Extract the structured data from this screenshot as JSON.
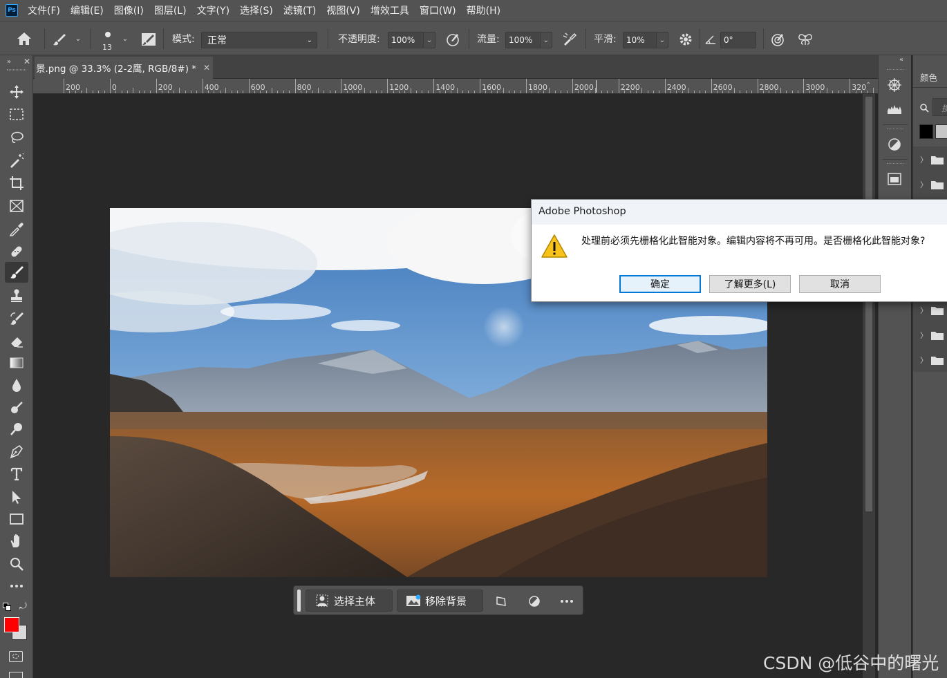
{
  "app": {
    "logo_text": "Ps"
  },
  "menu": [
    "文件(F)",
    "编辑(E)",
    "图像(I)",
    "图层(L)",
    "文字(Y)",
    "选择(S)",
    "滤镜(T)",
    "视图(V)",
    "增效工具",
    "窗口(W)",
    "帮助(H)"
  ],
  "options": {
    "brush_size": "13",
    "mode_label": "模式:",
    "mode_value": "正常",
    "opacity_label": "不透明度:",
    "opacity_value": "100%",
    "flow_label": "流量:",
    "flow_value": "100%",
    "smoothing_label": "平滑:",
    "smoothing_value": "10%",
    "angle_value": "0°"
  },
  "document": {
    "tab_title": "景.png @ 33.3% (2-2鹰, RGB/8#) *",
    "ruler_labels": [
      "200",
      "0",
      "200",
      "400",
      "600",
      "800",
      "1000",
      "1200",
      "1400",
      "1600",
      "1800",
      "2000",
      "2200",
      "2400",
      "2600",
      "2800",
      "3000",
      "320"
    ]
  },
  "context_bar": {
    "select_subject": "选择主体",
    "remove_background": "移除背景"
  },
  "right_panel": {
    "color_tab": "颜色",
    "search_hint": "搜"
  },
  "dialog": {
    "title": "Adobe Photoshop",
    "message": "处理前必须先栅格化此智能对象。编辑内容将不再可用。是否栅格化此智能对象?",
    "ok": "确定",
    "learn_more": "了解更多(L)",
    "cancel": "取消"
  },
  "colors": {
    "foreground": "#ff0000",
    "background": "#d9d9d9",
    "accent": "#31a8ff",
    "warning": "#f7c21a"
  },
  "watermark": "CSDN @低谷中的曙光"
}
